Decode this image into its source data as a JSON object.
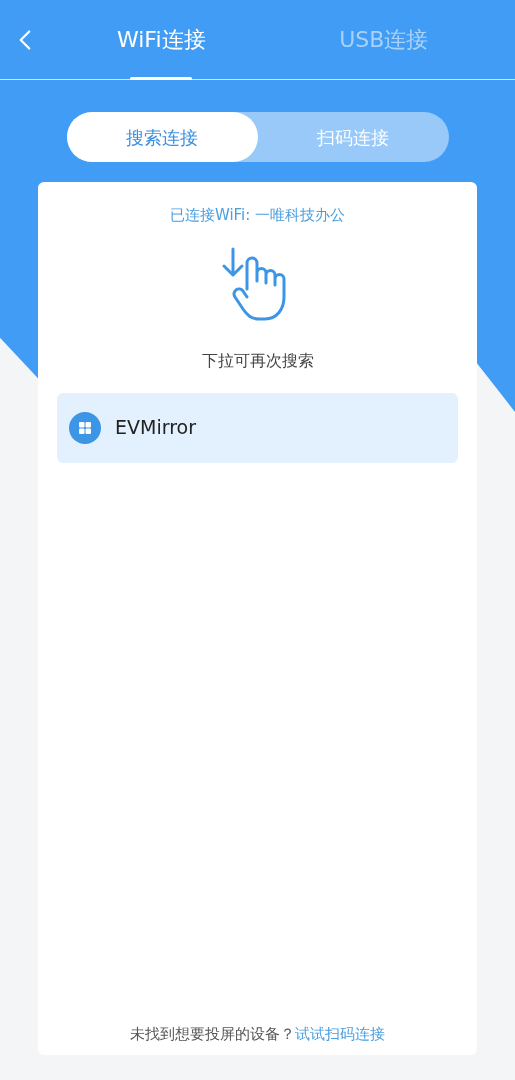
{
  "tabs": [
    {
      "label": "WiFi连接",
      "selected": true
    },
    {
      "label": "USB连接",
      "selected": false
    }
  ],
  "modes": [
    {
      "label": "搜索连接",
      "selected": true
    },
    {
      "label": "扫码连接",
      "selected": false
    }
  ],
  "connected_wifi": "已连接WiFi: 一唯科技办公",
  "pull_hint": "下拉可再次搜索",
  "devices": [
    {
      "name": "EVMirror",
      "kind": "windows"
    }
  ],
  "footer": {
    "text": "未找到想要投屏的设备？",
    "link": "试试扫码连接"
  }
}
